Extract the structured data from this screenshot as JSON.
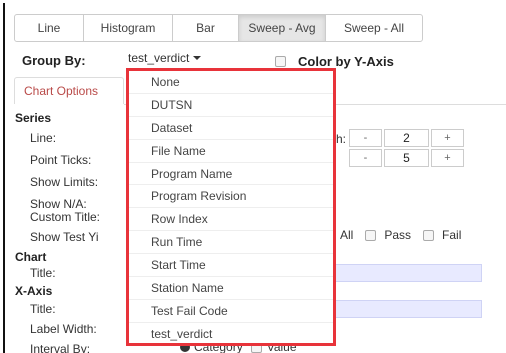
{
  "tabs": [
    {
      "label": "Line",
      "active": false
    },
    {
      "label": "Histogram",
      "active": false
    },
    {
      "label": "Bar",
      "active": false
    },
    {
      "label": "Sweep - Avg",
      "active": true
    },
    {
      "label": "Sweep - All",
      "active": false
    }
  ],
  "group_by": {
    "label": "Group By:",
    "selected": "test_verdict"
  },
  "color_by": {
    "label": "Color by Y-Axis",
    "checked": false
  },
  "chart_options_tab": "Chart Options",
  "series": {
    "heading": "Series",
    "line_label": "Line:",
    "point_ticks_label": "Point Ticks:",
    "show_limits_label": "Show Limits:",
    "show_na_label": "Show N/A:",
    "custom_title_label": "Custom Title:",
    "show_test_label": "Show Test Yi",
    "line_suffix": "h:",
    "line_spinner": {
      "minus": "-",
      "value": "2",
      "plus": "+"
    },
    "ticks_spinner": {
      "minus": "-",
      "value": "5",
      "plus": "+"
    },
    "verdict_options": [
      "All",
      "Pass",
      "Fail"
    ]
  },
  "chart": {
    "heading": "Chart",
    "title_label": "Title:"
  },
  "x_axis": {
    "heading": "X-Axis",
    "title_label": "Title:",
    "label_width_label": "Label Width:",
    "interval_by_label": "Interval By:",
    "interval_options": [
      "Category",
      "Value"
    ]
  },
  "dropdown": {
    "highlight_color": "#e8333a",
    "options": [
      "None",
      "DUTSN",
      "Dataset",
      "File Name",
      "Program Name",
      "Program Revision",
      "Row Index",
      "Run Time",
      "Start Time",
      "Station Name",
      "Test Fail Code",
      "test_verdict"
    ]
  }
}
